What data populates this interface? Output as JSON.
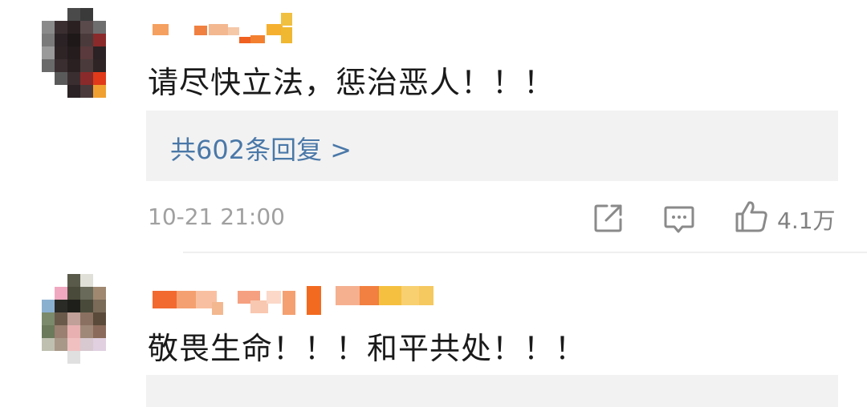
{
  "comments": [
    {
      "text": "请尽快立法，惩治恶人！！！",
      "replies_label": "共602条回复 >",
      "time": "10-21 21:00",
      "likes": "4.1万"
    },
    {
      "text": "敬畏生命！！！和平共处！！！"
    }
  ],
  "icons": {
    "share": "share-external-icon",
    "comment": "comment-bubble-icon",
    "like": "thumbs-up-icon"
  },
  "colors": {
    "reply_link": "#4a78a8",
    "timestamp": "#a0a0a0",
    "reply_box": "#f2f2f2"
  }
}
